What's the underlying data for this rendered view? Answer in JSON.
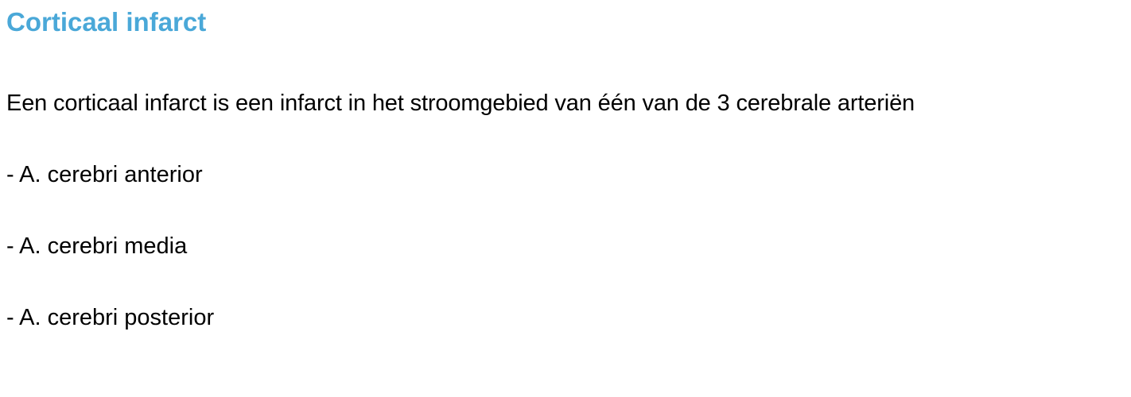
{
  "document": {
    "title": "Corticaal infarct",
    "intro": "Een corticaal infarct is een infarct in het stroomgebied van één van de 3 cerebrale arteriën",
    "arteries": [
      "- A. cerebri anterior",
      "- A. cerebri media",
      "- A. cerebri posterior"
    ]
  },
  "colors": {
    "title": "#4aa8d8",
    "text": "#000000",
    "background": "#ffffff"
  }
}
